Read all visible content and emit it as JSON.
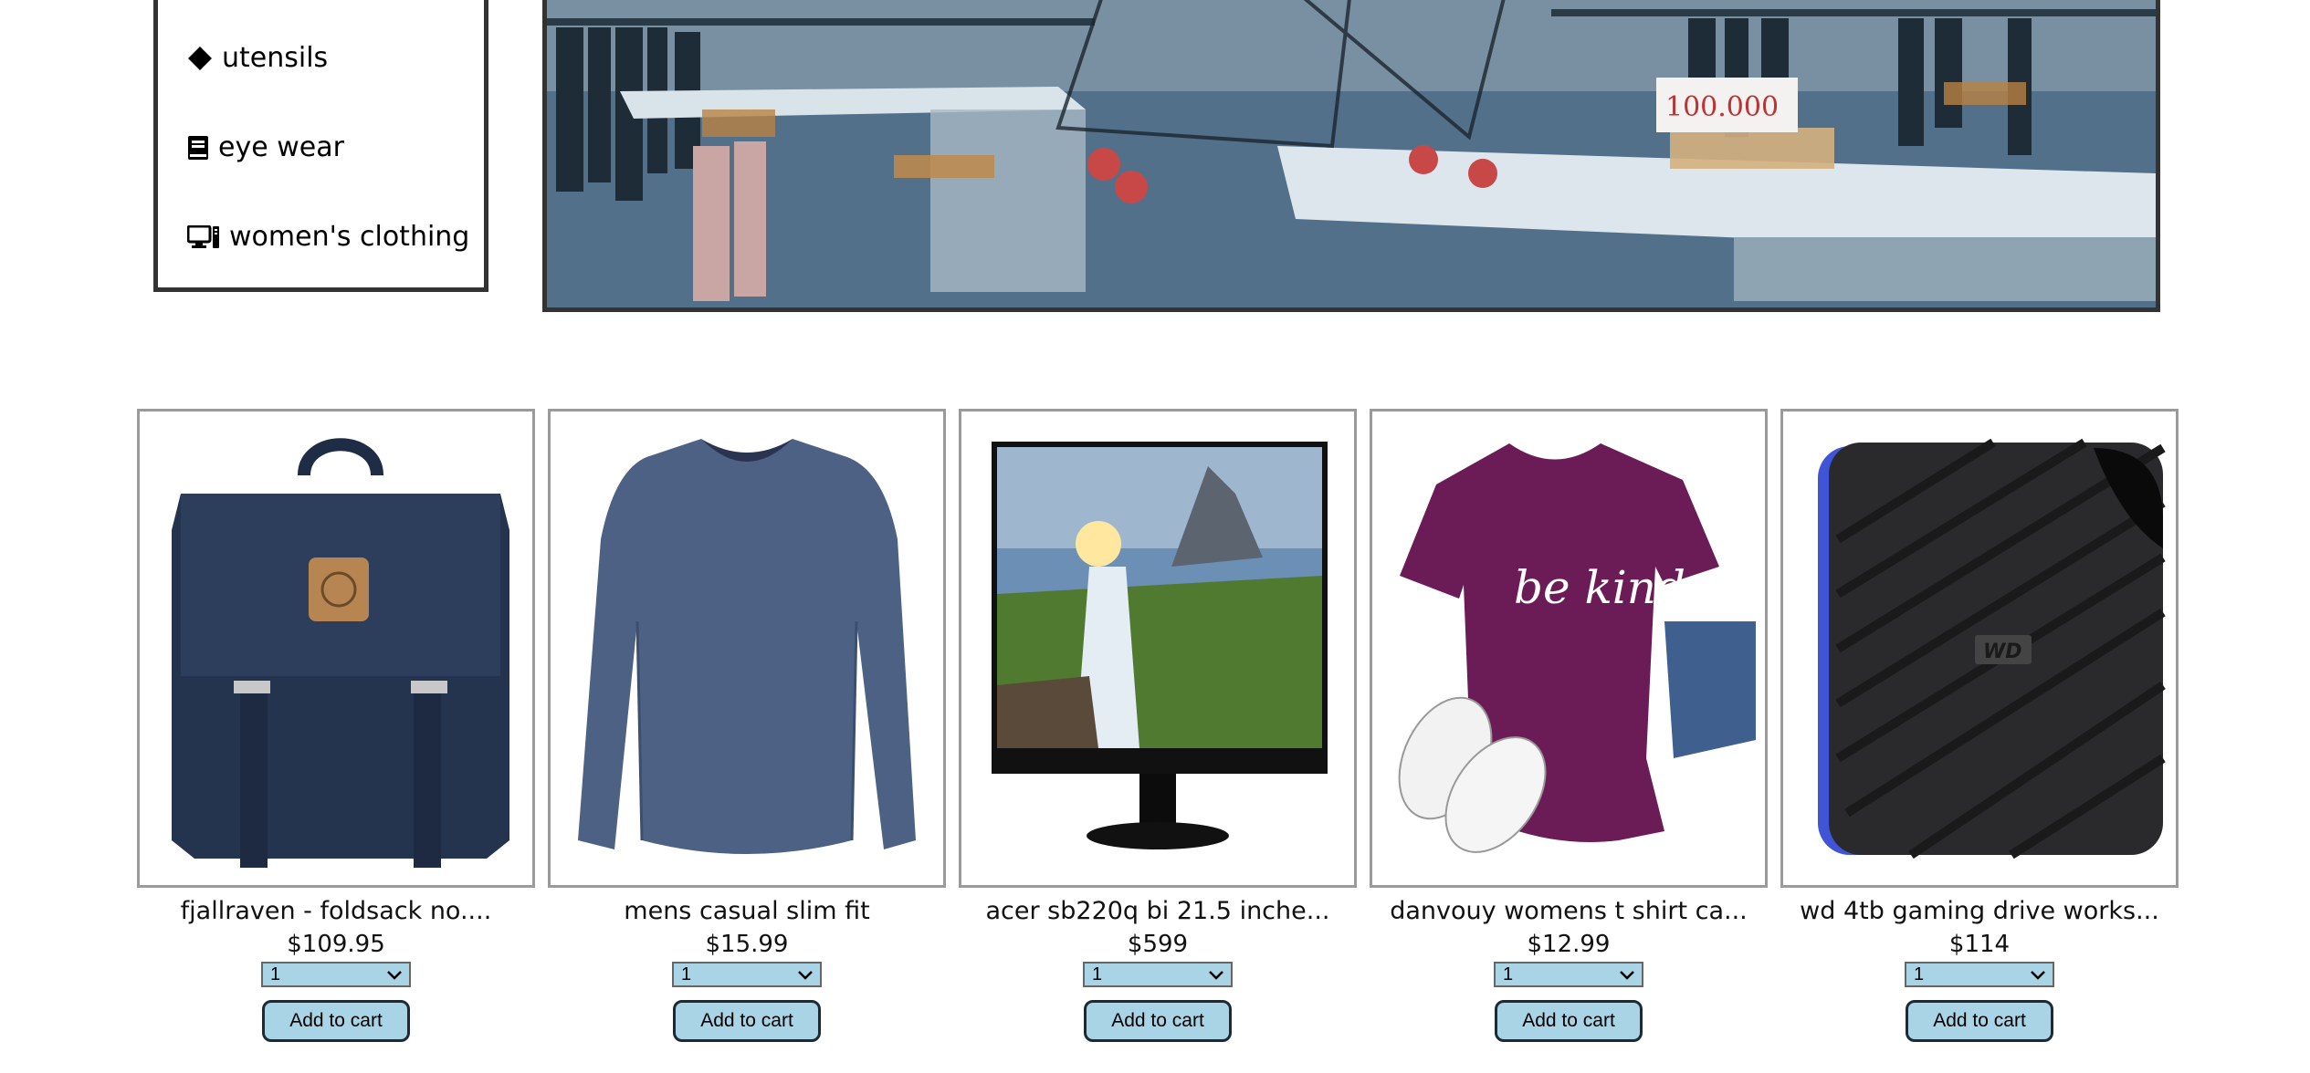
{
  "categories": [
    {
      "label": "utensils",
      "icon": "diamond-icon"
    },
    {
      "label": "eye wear",
      "icon": "book-icon"
    },
    {
      "label": "women's clothing",
      "icon": "desktop-icon"
    }
  ],
  "hero": {
    "sign_text": "100.000"
  },
  "products": [
    {
      "title": "fjallraven - foldsack no....",
      "price": "$109.95",
      "qty": "1",
      "button": "Add to cart",
      "image": "backpack"
    },
    {
      "title": "mens casual slim fit",
      "price": "$15.99",
      "qty": "1",
      "button": "Add to cart",
      "image": "long-sleeve-shirt"
    },
    {
      "title": "acer sb220q bi 21.5 inche...",
      "price": "$599",
      "qty": "1",
      "button": "Add to cart",
      "image": "monitor"
    },
    {
      "title": "danvouy womens t shirt ca...",
      "price": "$12.99",
      "qty": "1",
      "button": "Add to cart",
      "image": "purple-t-shirt",
      "shirt_text": "be kind"
    },
    {
      "title": "wd 4tb gaming drive works...",
      "price": "$114",
      "qty": "1",
      "button": "Add to cart",
      "image": "hard-drive",
      "logo_text": "WD"
    }
  ],
  "colors": {
    "button_bg": "#a8d4e6",
    "border": "#333333"
  }
}
